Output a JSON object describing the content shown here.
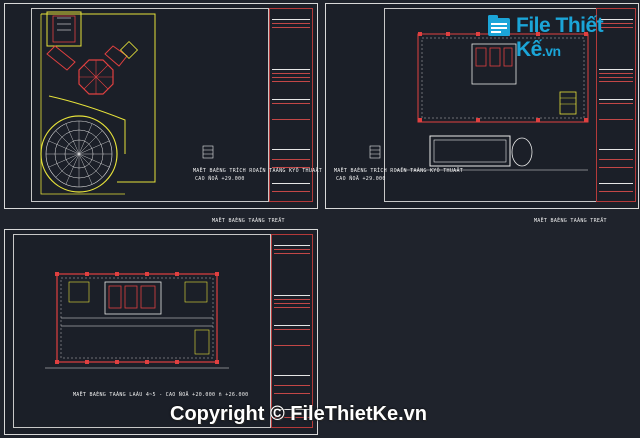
{
  "watermark": {
    "logo_text": "File Thiết Kế",
    "logo_suffix": ".vn",
    "copyright": "Copyright © FileThietKe.vn"
  },
  "sheet_a": {
    "caption_line1": "MAËT BAÈNG TRÍCH ROAÏN TAÀNG KYÕ THUAÄT",
    "caption_line2": "CAO ÑOÄ   +29.000",
    "title": "MAËT BAÈNG TAÀNG TREÄT"
  },
  "sheet_b": {
    "caption_line1": "MAËT BAÈNG TRÍCH ROAÏN TAÀNG KYÕ THUAÄT",
    "caption_line2": "CAO ÑOÄ   +29.000",
    "title": "MAËT BAÈNG TAÀNG TREÄT"
  },
  "sheet_c": {
    "caption": "MAËT BAÈNG TAÀNG LAÀU 4~5  -  CAO ÑOÄ  +20.000 ñ +26.000"
  },
  "colors": {
    "background": "#1f232c",
    "sheet_border": "#d9d9d9",
    "title_block": "#c34747",
    "cad_yellow": "#e6e23a",
    "cad_red": "#e04040",
    "cad_white": "#e8e8e8",
    "logo_blue": "#1ba5d8"
  }
}
